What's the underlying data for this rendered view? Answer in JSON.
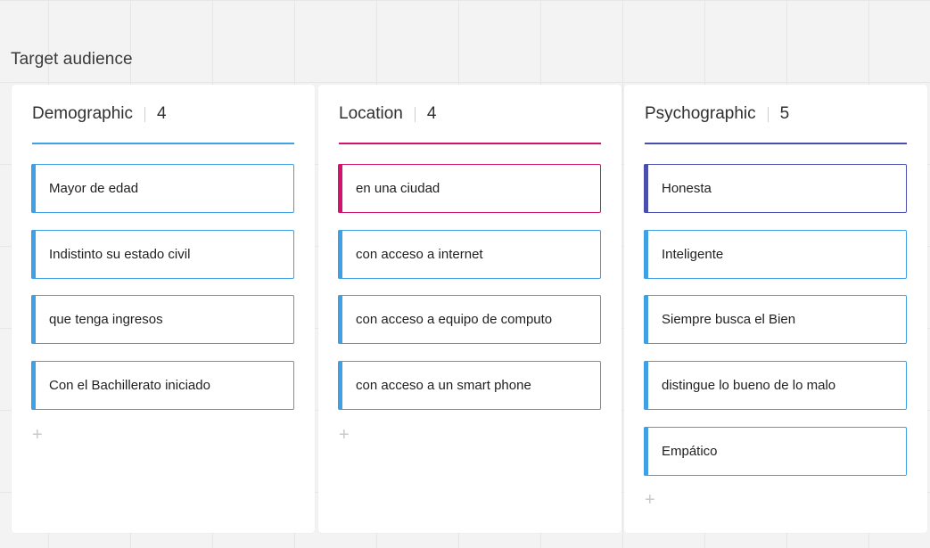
{
  "frame_title": "Target audience",
  "columns": [
    {
      "title": "Demographic",
      "count": "4",
      "accent": "#3fa0e6",
      "cards": [
        {
          "text": "Mayor de edad",
          "bar": "#3fa0e6",
          "border": "#3fa0e6"
        },
        {
          "text": "Indistinto su estado civil",
          "bar": "#3fa0e6",
          "border": "#3fa0e6"
        },
        {
          "text": "que tenga ingresos",
          "bar": "#3fa0e6",
          "border": "#3fa0e6"
        },
        {
          "text": "Con el Bachillerato iniciado",
          "bar": "#3fa0e6",
          "border": "#3fa0e6"
        }
      ],
      "add_icon": "plus-icon",
      "add_label": "+"
    },
    {
      "title": "Location",
      "count": "4",
      "accent": "#d3146f",
      "cards": [
        {
          "text": "en una ciudad",
          "bar": "#d3146f",
          "border": "#d3146f"
        },
        {
          "text": "con acceso a internet",
          "bar": "#3fa0e6",
          "border": "#3fa0e6"
        },
        {
          "text": "con acceso a equipo de computo",
          "bar": "#3fa0e6",
          "border": "#3fa0e6"
        },
        {
          "text": "con acceso a un smart phone",
          "bar": "#3fa0e6",
          "border": "#3fa0e6"
        }
      ],
      "add_icon": "plus-icon",
      "add_label": "+"
    },
    {
      "title": "Psychographic",
      "count": "5",
      "accent": "#4a4fae",
      "cards": [
        {
          "text": "Honesta",
          "bar": "#4a4fae",
          "border": "#4a4fae"
        },
        {
          "text": "Inteligente",
          "bar": "#3fa0e6",
          "border": "#3fa0e6"
        },
        {
          "text": "Siempre busca el Bien",
          "bar": "#3fa0e6",
          "border": "#3fa0e6"
        },
        {
          "text": "distingue lo bueno de lo malo",
          "bar": "#3fa0e6",
          "border": "#3fa0e6"
        },
        {
          "text": "Empático",
          "bar": "#3fa0e6",
          "border": "#3fa0e6"
        }
      ],
      "add_icon": "plus-icon",
      "add_label": "+"
    }
  ]
}
